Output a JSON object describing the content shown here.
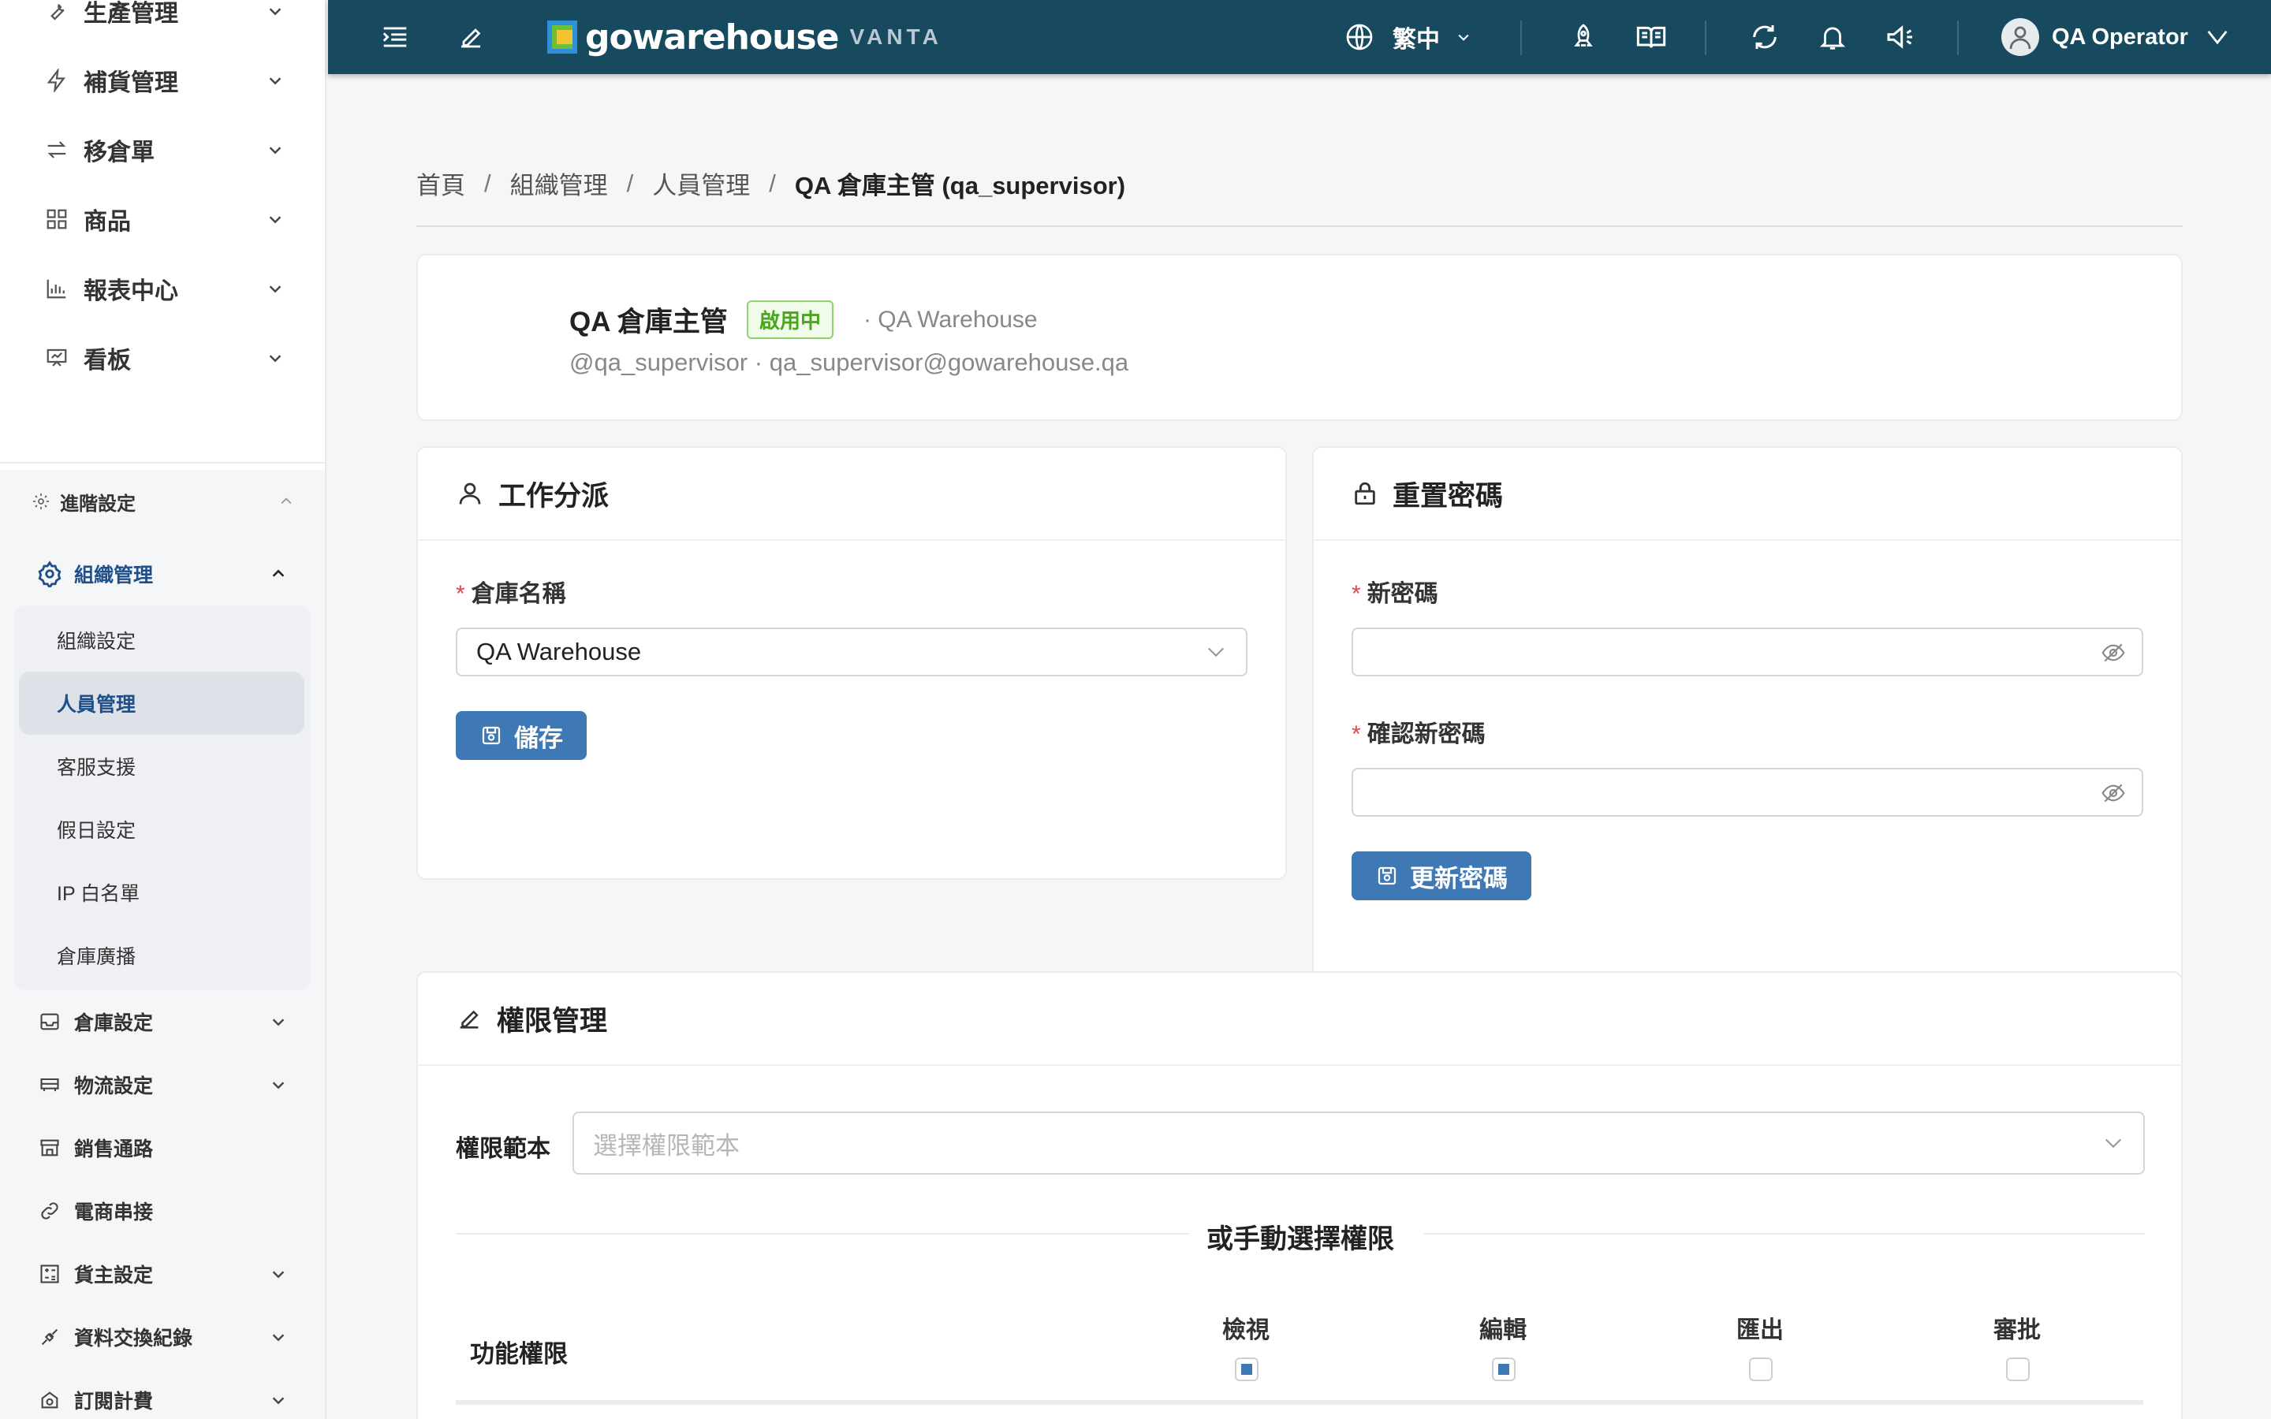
{
  "topbar": {
    "logo_text": "gowarehouse",
    "logo_sub": "VANTA",
    "language": "繁中",
    "user_name": "QA Operator",
    "colors": {
      "bar": "#17495f",
      "logo_yellow": "#f3c431",
      "logo_green": "#6bbf3a",
      "logo_blue": "#2f8fd8"
    }
  },
  "sidebar": {
    "top_items": [
      {
        "label": "生產管理",
        "icon": "wrench-icon"
      },
      {
        "label": "補貨管理",
        "icon": "bolt-icon"
      },
      {
        "label": "移倉單",
        "icon": "transfer-icon"
      },
      {
        "label": "商品",
        "icon": "grid-icon"
      },
      {
        "label": "報表中心",
        "icon": "bar-chart-icon"
      },
      {
        "label": "看板",
        "icon": "presentation-icon"
      }
    ],
    "advanced_label": "進階設定",
    "org_group_label": "組織管理",
    "org_sub_items": [
      "組織設定",
      "人員管理",
      "客服支援",
      "假日設定",
      "IP 白名單",
      "倉庫廣播"
    ],
    "selected_sub": "人員管理",
    "bottom_items": [
      {
        "label": "倉庫設定",
        "icon": "inbox-icon",
        "chevron": true
      },
      {
        "label": "物流設定",
        "icon": "truck-icon",
        "chevron": true
      },
      {
        "label": "銷售通路",
        "icon": "store-icon",
        "chevron": false
      },
      {
        "label": "電商串接",
        "icon": "link-icon",
        "chevron": false
      },
      {
        "label": "貨主設定",
        "icon": "calculator-icon",
        "chevron": true
      },
      {
        "label": "資料交換紀錄",
        "icon": "api-icon",
        "chevron": true
      },
      {
        "label": "訂閱計費",
        "icon": "billing-icon",
        "chevron": true
      }
    ]
  },
  "breadcrumb": [
    "首頁",
    "組織管理",
    "人員管理",
    "QA 倉庫主管 (qa_supervisor)"
  ],
  "profile": {
    "name": "QA 倉庫主管",
    "status": "啟用中",
    "warehouse": "· QA Warehouse",
    "subline": "@qa_supervisor · qa_supervisor@gowarehouse.qa",
    "status_color": "#4aa51f"
  },
  "assignment": {
    "title": "工作分派",
    "warehouse_label": "倉庫名稱",
    "warehouse_value": "QA Warehouse",
    "save_label": "儲存"
  },
  "reset_password": {
    "title": "重置密碼",
    "new_label": "新密碼",
    "confirm_label": "確認新密碼",
    "new_value": "",
    "confirm_value": "",
    "submit_label": "更新密碼"
  },
  "permissions": {
    "title": "權限管理",
    "template_label": "權限範本",
    "template_placeholder": "選擇權限範本",
    "manual_label": "或手動選擇權限",
    "function_label": "功能權限",
    "columns": [
      {
        "label": "檢視",
        "checked": true
      },
      {
        "label": "編輯",
        "checked": true
      },
      {
        "label": "匯出",
        "checked": false
      },
      {
        "label": "審批",
        "checked": false
      }
    ]
  },
  "accent_color": "#3f79b5"
}
